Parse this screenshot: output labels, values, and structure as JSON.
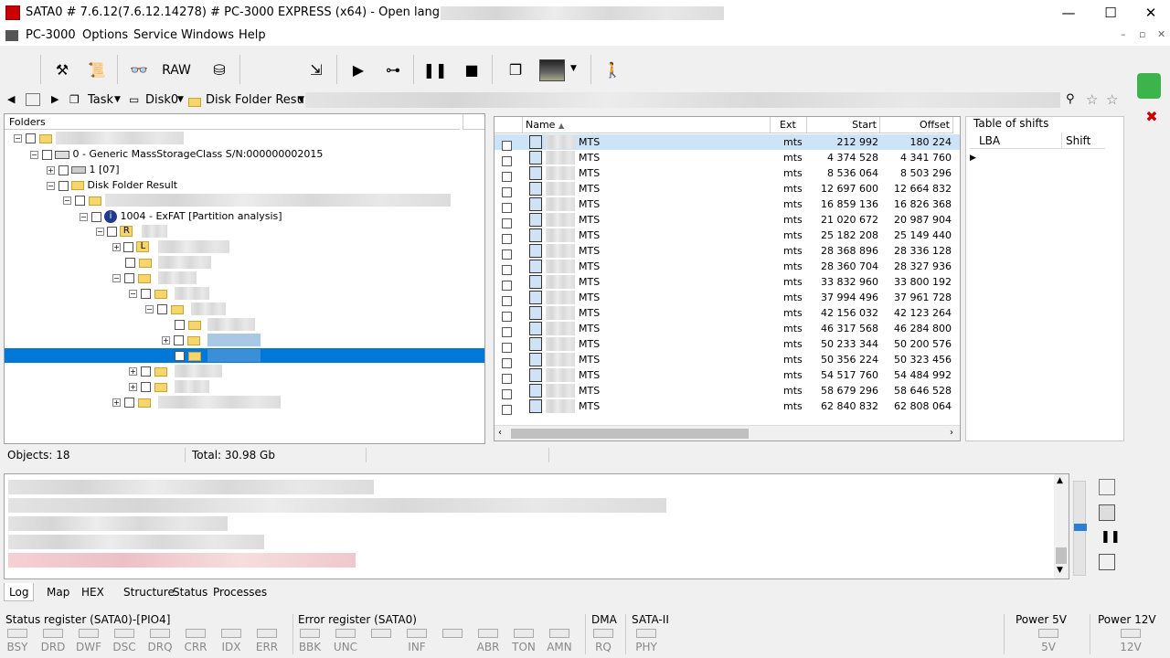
{
  "window": {
    "title": "SATA0 # 7.6.12(7.6.12.14278) # PC-3000 EXPRESS (x64) - Open language license -",
    "minimize": "—",
    "maximize": "☐",
    "close": "✕"
  },
  "menu": {
    "items": [
      "PC-3000",
      "Options",
      "Service",
      "Windows",
      "Help"
    ]
  },
  "toolbar": {
    "raw_label": "RAW"
  },
  "navbar": {
    "task_label": "Task",
    "disk_label": "Disk0",
    "result_label": "Disk Folder Result"
  },
  "folders": {
    "header": "Folders",
    "device": "0 - Generic MassStorageClass  S/N:000000002015",
    "node_1": "1 [07]",
    "disk_folder_result": "Disk Folder Result",
    "partition": "1004 - ExFAT [Partition analysis]",
    "root_label": "R",
    "lost_label": "L"
  },
  "files": {
    "columns": [
      "Name",
      "Ext",
      "Start",
      "Offset"
    ],
    "rows": [
      {
        "name": "MTS",
        "ext": "mts",
        "start": "212 992",
        "offset": "180 224"
      },
      {
        "name": "MTS",
        "ext": "mts",
        "start": "4 374 528",
        "offset": "4 341 760"
      },
      {
        "name": "MTS",
        "ext": "mts",
        "start": "8 536 064",
        "offset": "8 503 296"
      },
      {
        "name": "MTS",
        "ext": "mts",
        "start": "12 697 600",
        "offset": "12 664 832"
      },
      {
        "name": "MTS",
        "ext": "mts",
        "start": "16 859 136",
        "offset": "16 826 368"
      },
      {
        "name": "MTS",
        "ext": "mts",
        "start": "21 020 672",
        "offset": "20 987 904"
      },
      {
        "name": "MTS",
        "ext": "mts",
        "start": "25 182 208",
        "offset": "25 149 440"
      },
      {
        "name": "MTS",
        "ext": "mts",
        "start": "28 368 896",
        "offset": "28 336 128"
      },
      {
        "name": "MTS",
        "ext": "mts",
        "start": "28 360 704",
        "offset": "28 327 936"
      },
      {
        "name": "MTS",
        "ext": "mts",
        "start": "33 832 960",
        "offset": "33 800 192"
      },
      {
        "name": "MTS",
        "ext": "mts",
        "start": "37 994 496",
        "offset": "37 961 728"
      },
      {
        "name": "MTS",
        "ext": "mts",
        "start": "42 156 032",
        "offset": "42 123 264"
      },
      {
        "name": "MTS",
        "ext": "mts",
        "start": "46 317 568",
        "offset": "46 284 800"
      },
      {
        "name": "MTS",
        "ext": "mts",
        "start": "50 233 344",
        "offset": "50 200 576"
      },
      {
        "name": "MTS",
        "ext": "mts",
        "start": "50 356 224",
        "offset": "50 323 456"
      },
      {
        "name": "MTS",
        "ext": "mts",
        "start": "54 517 760",
        "offset": "54 484 992"
      },
      {
        "name": "MTS",
        "ext": "mts",
        "start": "58 679 296",
        "offset": "58 646 528"
      },
      {
        "name": "MTS",
        "ext": "mts",
        "start": "62 840 832",
        "offset": "62 808 064"
      }
    ]
  },
  "shifts": {
    "title": "Table of shifts",
    "col_lba": "LBA",
    "col_shift": "Shift"
  },
  "status": {
    "objects": "Objects: 18",
    "total": "Total: 30.98 Gb"
  },
  "tabs": [
    "Log",
    "Map",
    "HEX",
    "Structure",
    "Status",
    "Processes"
  ],
  "registers": {
    "status_title": "Status register (SATA0)-[PIO4]",
    "status_bits": [
      "BSY",
      "DRD",
      "DWF",
      "DSC",
      "DRQ",
      "CRR",
      "IDX",
      "ERR"
    ],
    "error_title": "Error register (SATA0)",
    "error_bits": [
      "BBK",
      "UNC",
      "",
      "INF",
      "",
      "ABR",
      "TON",
      "AMN"
    ],
    "dma_title": "DMA",
    "dma_bit": "RQ",
    "sata_title": "SATA-II",
    "sata_bit": "PHY",
    "power5_title": "Power 5V",
    "power5_bit": "5V",
    "power12_title": "Power 12V",
    "power12_bit": "12V"
  },
  "colors": {
    "selection": "#0078d7",
    "row_highlight": "#cde3f7"
  }
}
